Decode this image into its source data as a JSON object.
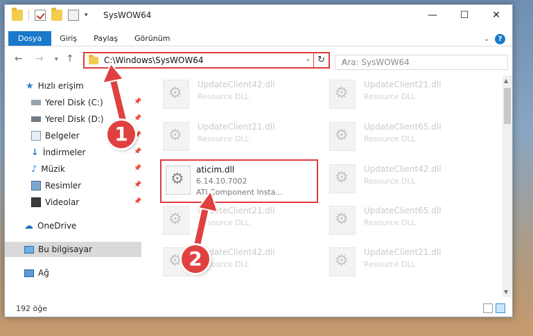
{
  "window": {
    "title": "SysWOW64",
    "controls": {
      "minimize": "—",
      "maximize": "☐",
      "close": "✕"
    }
  },
  "ribbon": {
    "tabs": [
      "Dosya",
      "Giriş",
      "Paylaş",
      "Görünüm"
    ]
  },
  "address": {
    "path": "C:\\Windows\\SysWOW64",
    "search_placeholder": "Ara: SysWOW64"
  },
  "sidebar": {
    "items": [
      {
        "label": "Hızlı erişim",
        "icon": "star-icon"
      },
      {
        "label": "Yerel Disk (C:)",
        "icon": "drive-icon",
        "pinned": true
      },
      {
        "label": "Yerel Disk (D:)",
        "icon": "drive-icon",
        "pinned": true
      },
      {
        "label": "Belgeler",
        "icon": "document-icon",
        "pinned": true
      },
      {
        "label": "İndirmeler",
        "icon": "download-icon",
        "pinned": true
      },
      {
        "label": "Müzik",
        "icon": "music-icon",
        "pinned": true
      },
      {
        "label": "Resimler",
        "icon": "pictures-icon",
        "pinned": true
      },
      {
        "label": "Videolar",
        "icon": "video-icon",
        "pinned": true
      },
      {
        "label": "OneDrive",
        "icon": "cloud-icon"
      },
      {
        "label": "Bu bilgisayar",
        "icon": "computer-icon",
        "selected": true
      },
      {
        "label": "Ağ",
        "icon": "network-icon"
      }
    ]
  },
  "files": {
    "left": [
      {
        "name": "UpdateClient42.dll",
        "desc": "Resource DLL"
      },
      {
        "name": "UpdateClient21.dll",
        "desc": "Resource DLL"
      },
      {
        "name": "UpdateClient21.dll",
        "desc": "Resource DLL"
      },
      {
        "name": "UpdateClient42.dll",
        "desc": "Resource DLL"
      }
    ],
    "right": [
      {
        "name": "UpdateClient21.dll",
        "desc": "Resource DLL"
      },
      {
        "name": "UpdateClient65.dll",
        "desc": "Resource DLL"
      },
      {
        "name": "UpdateClient42.dll",
        "desc": "Resource DLL"
      },
      {
        "name": "UpdateClient65.dll",
        "desc": "Resource DLL"
      },
      {
        "name": "UpdateClient21.dll",
        "desc": "Resource DLL"
      }
    ],
    "highlighted": {
      "name": "aticim.dll",
      "version": "6.14.10.7002",
      "description": "ATI Component Insta..."
    }
  },
  "status": {
    "item_count": "192 öğe"
  },
  "annotations": {
    "step1": "1",
    "step2": "2",
    "color": "#e04040"
  }
}
